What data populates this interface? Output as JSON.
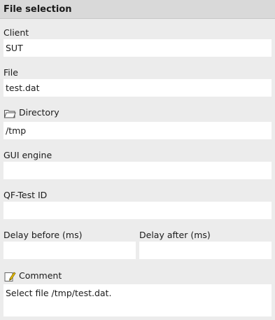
{
  "header": {
    "title": "File selection"
  },
  "client": {
    "label": "Client",
    "value": "SUT"
  },
  "file": {
    "label": "File",
    "value": "test.dat"
  },
  "directory": {
    "label": "Directory",
    "value": "/tmp",
    "icon": "folder-icon"
  },
  "gui_engine": {
    "label": "GUI engine",
    "value": ""
  },
  "qftest_id": {
    "label": "QF-Test ID",
    "value": ""
  },
  "delay_before": {
    "label": "Delay before (ms)",
    "value": ""
  },
  "delay_after": {
    "label": "Delay after (ms)",
    "value": ""
  },
  "comment": {
    "label": "Comment",
    "value": "Select file /tmp/test.dat.",
    "icon": "pencil-note-icon"
  }
}
